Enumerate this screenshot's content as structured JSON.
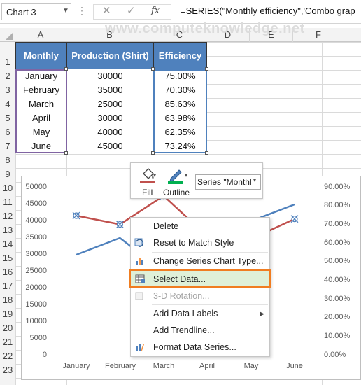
{
  "formula_bar": {
    "name_box": "Chart 3",
    "formula": "=SERIES(\"Monthly efficiency\",'Combo grap"
  },
  "watermark": "www.computeknowledge.net",
  "columns": [
    "A",
    "B",
    "C",
    "D",
    "E",
    "F"
  ],
  "rows": [
    "1",
    "2",
    "3",
    "4",
    "5",
    "6",
    "7",
    "8",
    "9",
    "10",
    "11",
    "12",
    "13",
    "14",
    "15",
    "16",
    "17",
    "18",
    "19",
    "20",
    "21",
    "22",
    "23"
  ],
  "table": {
    "headers": [
      "Monthly",
      "Production (Shirt)",
      "Efficiency"
    ],
    "rows": [
      [
        "January",
        "30000",
        "75.00%"
      ],
      [
        "February",
        "35000",
        "70.30%"
      ],
      [
        "March",
        "25000",
        "85.63%"
      ],
      [
        "April",
        "30000",
        "63.98%"
      ],
      [
        "May",
        "40000",
        "62.35%"
      ],
      [
        "June",
        "45000",
        "73.24%"
      ]
    ]
  },
  "chart_data": {
    "type": "line",
    "categories": [
      "January",
      "February",
      "March",
      "April",
      "May",
      "June"
    ],
    "series": [
      {
        "name": "Production (Shirt)",
        "axis": "primary",
        "color": "#4f81bd",
        "values": [
          30000,
          35000,
          25000,
          30000,
          40000,
          45000
        ]
      },
      {
        "name": "Monthly efficiency",
        "axis": "secondary",
        "color": "#c0504d",
        "values": [
          75.0,
          70.3,
          85.63,
          63.98,
          62.35,
          73.24
        ]
      }
    ],
    "y_left_ticks": [
      "50000",
      "45000",
      "40000",
      "35000",
      "30000",
      "25000",
      "20000",
      "15000",
      "10000",
      "5000",
      "0"
    ],
    "y_right_ticks": [
      "90.00%",
      "80.00%",
      "70.00%",
      "60.00%",
      "50.00%",
      "40.00%",
      "30.00%",
      "20.00%",
      "10.00%",
      "0.00%"
    ],
    "ylim_left": [
      0,
      50000
    ],
    "ylim_right": [
      0,
      90
    ]
  },
  "mini_toolbar": {
    "fill_label": "Fill",
    "outline_label": "Outline",
    "series_select_value": "Series \"Monthl"
  },
  "context_menu": {
    "items": [
      {
        "label": "Delete",
        "icon": "delete-icon"
      },
      {
        "label": "Reset to Match Style",
        "icon": "reset-style-icon"
      },
      {
        "label": "Change Series Chart Type...",
        "icon": "chart-type-icon"
      },
      {
        "label": "Select Data...",
        "icon": "select-data-icon"
      },
      {
        "label": "3-D Rotation...",
        "icon": "rotation-icon",
        "disabled": true
      },
      {
        "label": "Add Data Labels",
        "submenu": true
      },
      {
        "label": "Add Trendline..."
      },
      {
        "label": "Format Data Series...",
        "icon": "format-series-icon"
      }
    ]
  },
  "colors": {
    "header_blue": "#4f81bd",
    "highlight_orange": "#f07d21",
    "fill_red": "#c0504d",
    "outline_green": "#00b050"
  }
}
